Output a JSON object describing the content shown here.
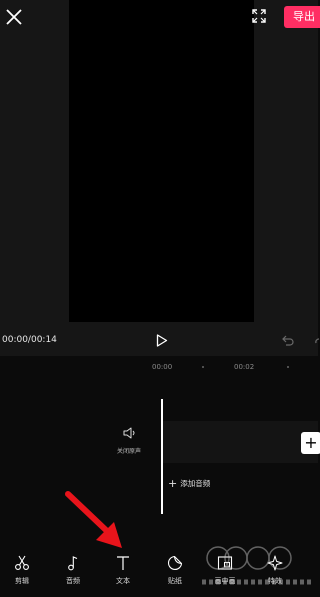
{
  "header": {
    "export_label": "导出"
  },
  "player": {
    "timecode": "00:00/00:14"
  },
  "timeline": {
    "ruler": [
      "00:00",
      "00:02"
    ],
    "mute_label": "关闭原声",
    "add_clip_symbol": "+",
    "add_audio_symbol": "+",
    "add_audio_label": "添加音频"
  },
  "toolbar": {
    "items": [
      {
        "label": "剪辑",
        "icon": "scissors-icon"
      },
      {
        "label": "音频",
        "icon": "music-note-icon"
      },
      {
        "label": "文本",
        "icon": "text-icon"
      },
      {
        "label": "贴纸",
        "icon": "sticker-icon"
      },
      {
        "label": "画中画",
        "icon": "picture-in-picture-icon"
      },
      {
        "label": "特效",
        "icon": "effects-icon"
      }
    ]
  },
  "colors": {
    "accent": "#ff2e63",
    "background": "#0b0b0b",
    "annotation_arrow": "#e8141b"
  }
}
